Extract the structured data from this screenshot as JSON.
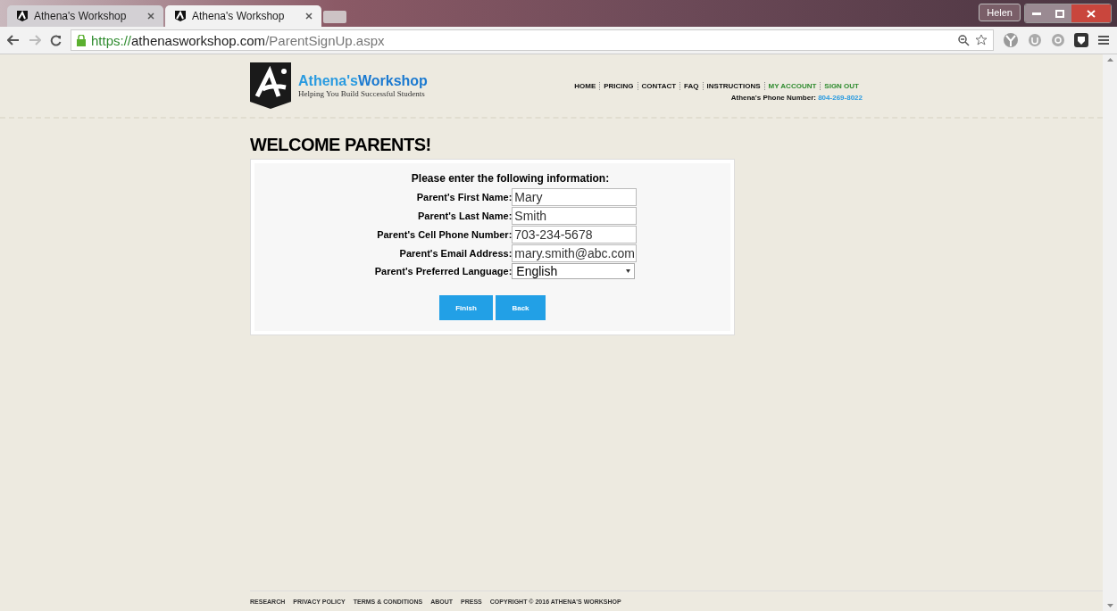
{
  "browser": {
    "tabs": [
      {
        "title": "Athena's Workshop",
        "selected": false
      },
      {
        "title": "Athena's Workshop",
        "selected": true
      }
    ],
    "profile": "Helen",
    "url": {
      "scheme": "https://",
      "host": "athenasworkshop.com",
      "path": "/ParentSignUp.aspx"
    }
  },
  "header": {
    "brand_first": "Athena's",
    "brand_second": "Workshop",
    "tagline": "Helping You Build Successful Students",
    "nav": [
      {
        "label": "HOME",
        "kind": "plain"
      },
      {
        "label": "PRICING",
        "kind": "plain"
      },
      {
        "label": "CONTACT",
        "kind": "plain"
      },
      {
        "label": "FAQ",
        "kind": "plain"
      },
      {
        "label": "INSTRUCTIONS",
        "kind": "plain"
      },
      {
        "label": "MY ACCOUNT",
        "kind": "account"
      },
      {
        "label": "SIGN OUT",
        "kind": "account"
      }
    ],
    "phone_label": "Athena's Phone Number:",
    "phone": "804-269-8022"
  },
  "page_title": "WELCOME PARENTS!",
  "form": {
    "intro": "Please enter the following information:",
    "fields": [
      {
        "label": "Parent's First Name:",
        "kind": "text",
        "value": "Mary"
      },
      {
        "label": "Parent's Last Name:",
        "kind": "text",
        "value": "Smith"
      },
      {
        "label": "Parent's Cell Phone Number:",
        "kind": "text",
        "value": "703-234-5678"
      },
      {
        "label": "Parent's Email Address:",
        "kind": "text",
        "value": "mary.smith@abc.com"
      },
      {
        "label": "Parent's Preferred Language:",
        "kind": "select",
        "value": "English"
      }
    ],
    "buttons": [
      "Finish",
      "Back"
    ]
  },
  "footer": [
    "RESEARCH",
    "PRIVACY POLICY",
    "TERMS & CONDITIONS",
    "ABOUT",
    "PRESS",
    "COPYRIGHT © 2016 ATHENA'S WORKSHOP"
  ]
}
